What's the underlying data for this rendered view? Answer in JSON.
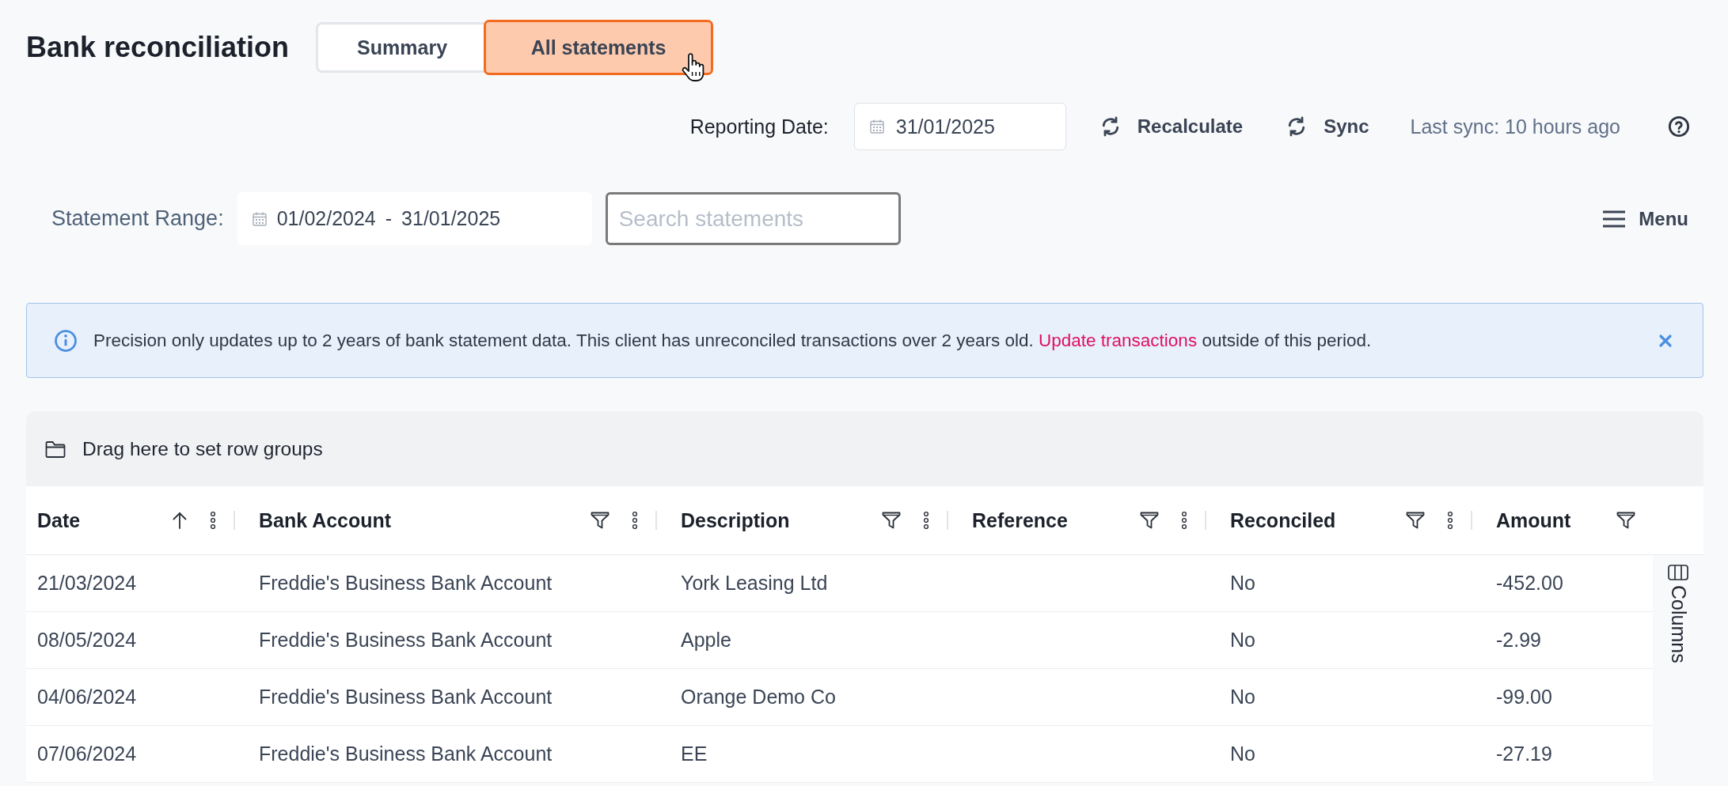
{
  "header": {
    "title": "Bank reconciliation",
    "tabs": [
      {
        "label": "Summary",
        "selected": false
      },
      {
        "label": "All statements",
        "selected": true
      }
    ]
  },
  "toolbar": {
    "reporting_date_label": "Reporting Date:",
    "reporting_date": "31/01/2025",
    "recalculate": "Recalculate",
    "sync": "Sync",
    "last_sync": "Last sync: 10 hours ago"
  },
  "filters": {
    "statement_range_label": "Statement Range:",
    "range_start": "01/02/2024",
    "range_separator": "-",
    "range_end": "31/01/2025",
    "search": {
      "placeholder": "Search statements"
    },
    "menu": "Menu"
  },
  "banner": {
    "before": "Precision only updates up to 2 years of bank statement data. This client has unreconciled transactions over 2 years old. ",
    "link": "Update transactions",
    "after": " outside of this period."
  },
  "table": {
    "group_hint": "Drag here to set row groups",
    "side_panel": "Columns",
    "columns": [
      {
        "label": "Date",
        "sorted": true,
        "filter": false,
        "menu": true
      },
      {
        "label": "Bank Account",
        "sorted": false,
        "filter": true,
        "menu": true
      },
      {
        "label": "Description",
        "sorted": false,
        "filter": true,
        "menu": true
      },
      {
        "label": "Reference",
        "sorted": false,
        "filter": true,
        "menu": true
      },
      {
        "label": "Reconciled",
        "sorted": false,
        "filter": true,
        "menu": true
      },
      {
        "label": "Amount",
        "sorted": false,
        "filter": true,
        "menu": false
      }
    ],
    "rows": [
      {
        "date": "21/03/2024",
        "bank_account": "Freddie's Business Bank Account",
        "description": "York Leasing Ltd",
        "reconciled": "No",
        "amount": "-452.00"
      },
      {
        "date": "08/05/2024",
        "bank_account": "Freddie's Business Bank Account",
        "description": "Apple",
        "reconciled": "No",
        "amount": "-2.99"
      },
      {
        "date": "04/06/2024",
        "bank_account": "Freddie's Business Bank Account",
        "description": "Orange Demo Co",
        "reconciled": "No",
        "amount": "-99.00"
      },
      {
        "date": "07/06/2024",
        "bank_account": "Freddie's Business Bank Account",
        "description": "EE",
        "reconciled": "No",
        "amount": "-27.19"
      }
    ]
  }
}
